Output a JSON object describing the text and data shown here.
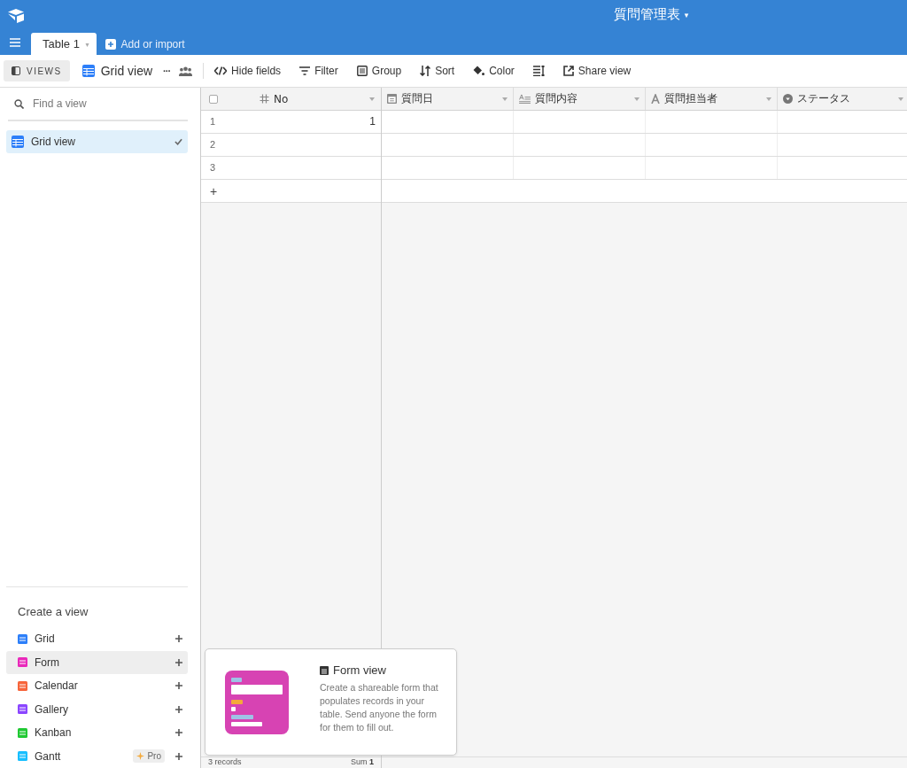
{
  "app_bar": {
    "base_title": "質問管理表",
    "caret": "▾"
  },
  "table_tabs": [
    {
      "label": "Table 1",
      "selected": true,
      "caret": "▾"
    }
  ],
  "add_table": {
    "label": "Add or import"
  },
  "toolbar": {
    "views_toggle": "VIEWS",
    "current_view": "Grid view",
    "more": "···",
    "buttons": [
      {
        "kind": "hide",
        "label": "Hide fields"
      },
      {
        "kind": "filter",
        "label": "Filter"
      },
      {
        "kind": "group",
        "label": "Group"
      },
      {
        "kind": "sort",
        "label": "Sort"
      },
      {
        "kind": "color",
        "label": "Color"
      },
      {
        "kind": "height"
      },
      {
        "kind": "share",
        "label": "Share view"
      }
    ]
  },
  "sidebar": {
    "search": {
      "placeholder": "Find a view"
    },
    "views": [
      {
        "label": "Grid view",
        "selected": true
      }
    ],
    "create_title": "Create a view",
    "create_items": [
      {
        "label": "Grid",
        "color": "#2d7ff9",
        "selected": false
      },
      {
        "label": "Form",
        "color": "#e929ba",
        "selected": true
      },
      {
        "label": "Calendar",
        "color": "#f7653b",
        "selected": false
      },
      {
        "label": "Gallery",
        "color": "#8b46ff",
        "selected": false
      },
      {
        "label": "Kanban",
        "color": "#20c933",
        "selected": false
      },
      {
        "label": "Gantt",
        "color": "#18bfff",
        "selected": false,
        "badge": "Pro"
      }
    ]
  },
  "grid": {
    "select_all": {
      "checked": false
    },
    "columns": [
      {
        "kind": "number",
        "name": "No"
      },
      {
        "kind": "date",
        "name": "質問日"
      },
      {
        "kind": "longtext",
        "name": "質問内容"
      },
      {
        "kind": "text",
        "name": "質問担当者"
      },
      {
        "kind": "select",
        "name": "ステータス"
      }
    ],
    "rows": [
      {
        "number": "1",
        "cells": [
          "1",
          "",
          "",
          "",
          ""
        ]
      },
      {
        "number": "2",
        "cells": [
          "",
          "",
          "",
          "",
          ""
        ]
      },
      {
        "number": "3",
        "cells": [
          "",
          "",
          "",
          "",
          ""
        ]
      }
    ],
    "add_row": "+",
    "footer": {
      "records": "3 records",
      "sum_label": "Sum",
      "sum_value": "1"
    }
  },
  "popover": {
    "title": "Form view",
    "description": "Create a shareable form that populates records in your table. Send anyone the form for them to fill out."
  }
}
